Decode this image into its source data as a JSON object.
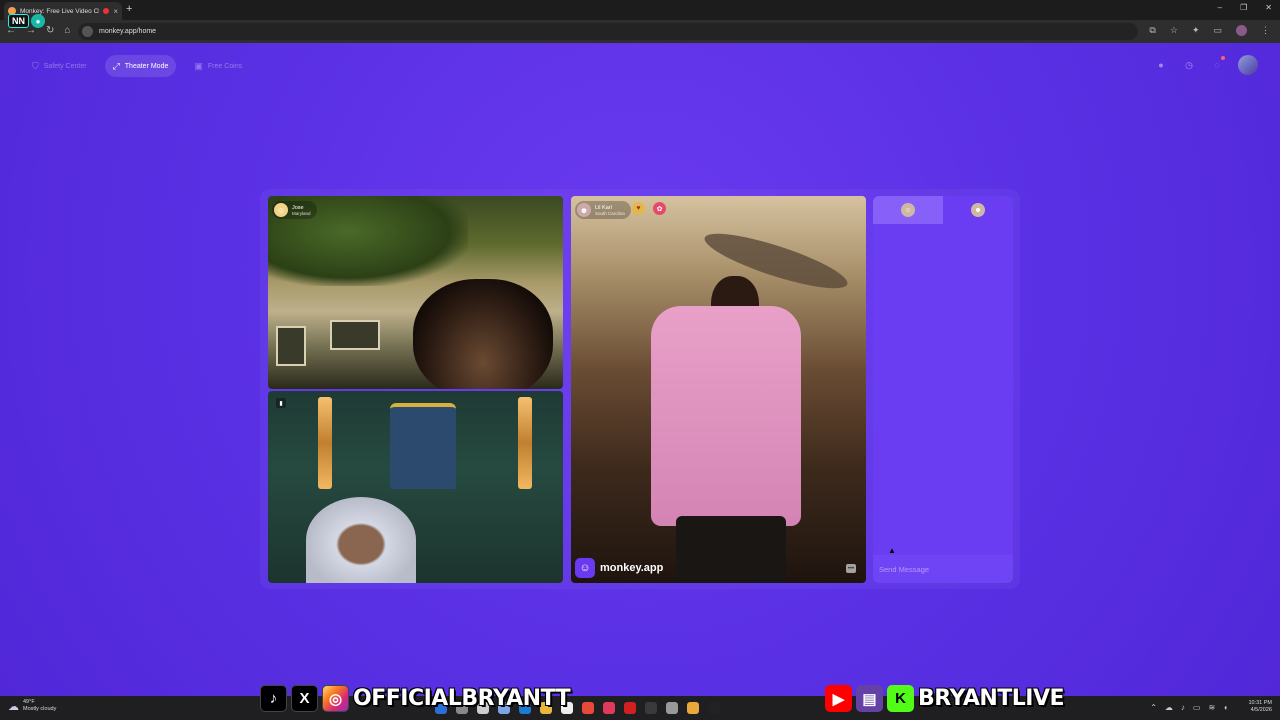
{
  "browser": {
    "tab_title": "Monkey: Free Live Video Ch...",
    "tab_close": "×",
    "new_tab": "+",
    "url": "monkey.app/home",
    "window_controls": [
      "–",
      "❐",
      "✕"
    ]
  },
  "overlay_logo": {
    "text": "NN"
  },
  "nav": {
    "items": [
      {
        "label": "Safety Center",
        "icon": "shield-icon"
      },
      {
        "label": "Theater Mode",
        "icon": "expand-icon"
      },
      {
        "label": "Free Coins",
        "icon": "gift-icon"
      }
    ]
  },
  "videos": {
    "top_left": {
      "name": "Jose",
      "location": "Maryland"
    },
    "right": {
      "name": "Lil Karl",
      "location": "South Carolina"
    }
  },
  "watermark": {
    "text": "monkey.app"
  },
  "chat": {
    "input_placeholder": "Send Message"
  },
  "taskbar": {
    "temperature": "49°F",
    "condition": "Mostly cloudy",
    "time": "10:31 PM",
    "date": "4/5/2026"
  },
  "socials": {
    "left_handle": "OFFICIALBRYANTT",
    "right_handle": "BRYANTLIVE"
  },
  "colors": {
    "page_bg": "#5a30e4",
    "chat_bg": "#6a3cf2",
    "accent": "#8660f8"
  }
}
